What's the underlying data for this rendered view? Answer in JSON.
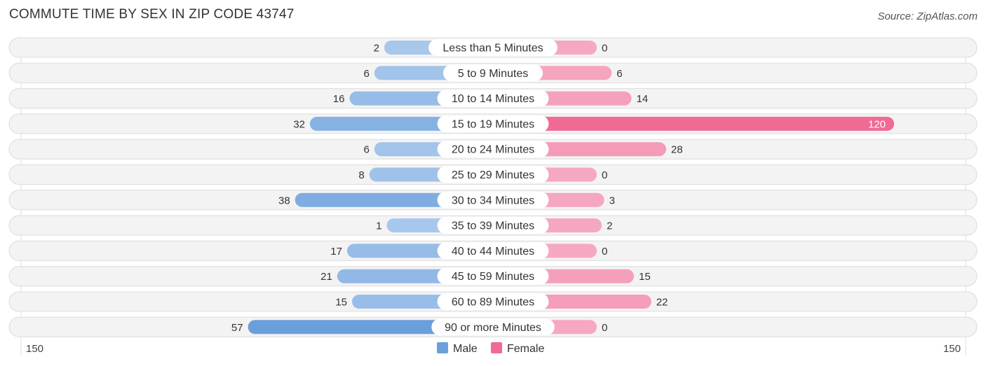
{
  "header": {
    "title": "COMMUTE TIME BY SEX IN ZIP CODE 43747",
    "source": "Source: ZipAtlas.com"
  },
  "colors": {
    "male_strong": "#6a9fdc",
    "male_light": "#a9c8ec",
    "female_strong": "#f06a94",
    "female_light": "#f6a8c1",
    "row_bg": "#f3f3f3"
  },
  "chart_data": {
    "type": "bar",
    "orientation": "horizontal-diverging",
    "title": "COMMUTE TIME BY SEX IN ZIP CODE 43747",
    "categories": [
      "Less than 5 Minutes",
      "5 to 9 Minutes",
      "10 to 14 Minutes",
      "15 to 19 Minutes",
      "20 to 24 Minutes",
      "25 to 29 Minutes",
      "30 to 34 Minutes",
      "35 to 39 Minutes",
      "40 to 44 Minutes",
      "45 to 59 Minutes",
      "60 to 89 Minutes",
      "90 or more Minutes"
    ],
    "series": [
      {
        "name": "Male",
        "values": [
          2,
          6,
          16,
          32,
          6,
          8,
          38,
          1,
          17,
          21,
          15,
          57
        ]
      },
      {
        "name": "Female",
        "values": [
          0,
          6,
          14,
          120,
          28,
          0,
          3,
          2,
          0,
          15,
          22,
          0
        ]
      }
    ],
    "axis_left_label": "150",
    "axis_right_label": "150",
    "xlim": [
      0,
      150
    ],
    "legend": [
      "Male",
      "Female"
    ],
    "legend_position": "bottom-center"
  }
}
